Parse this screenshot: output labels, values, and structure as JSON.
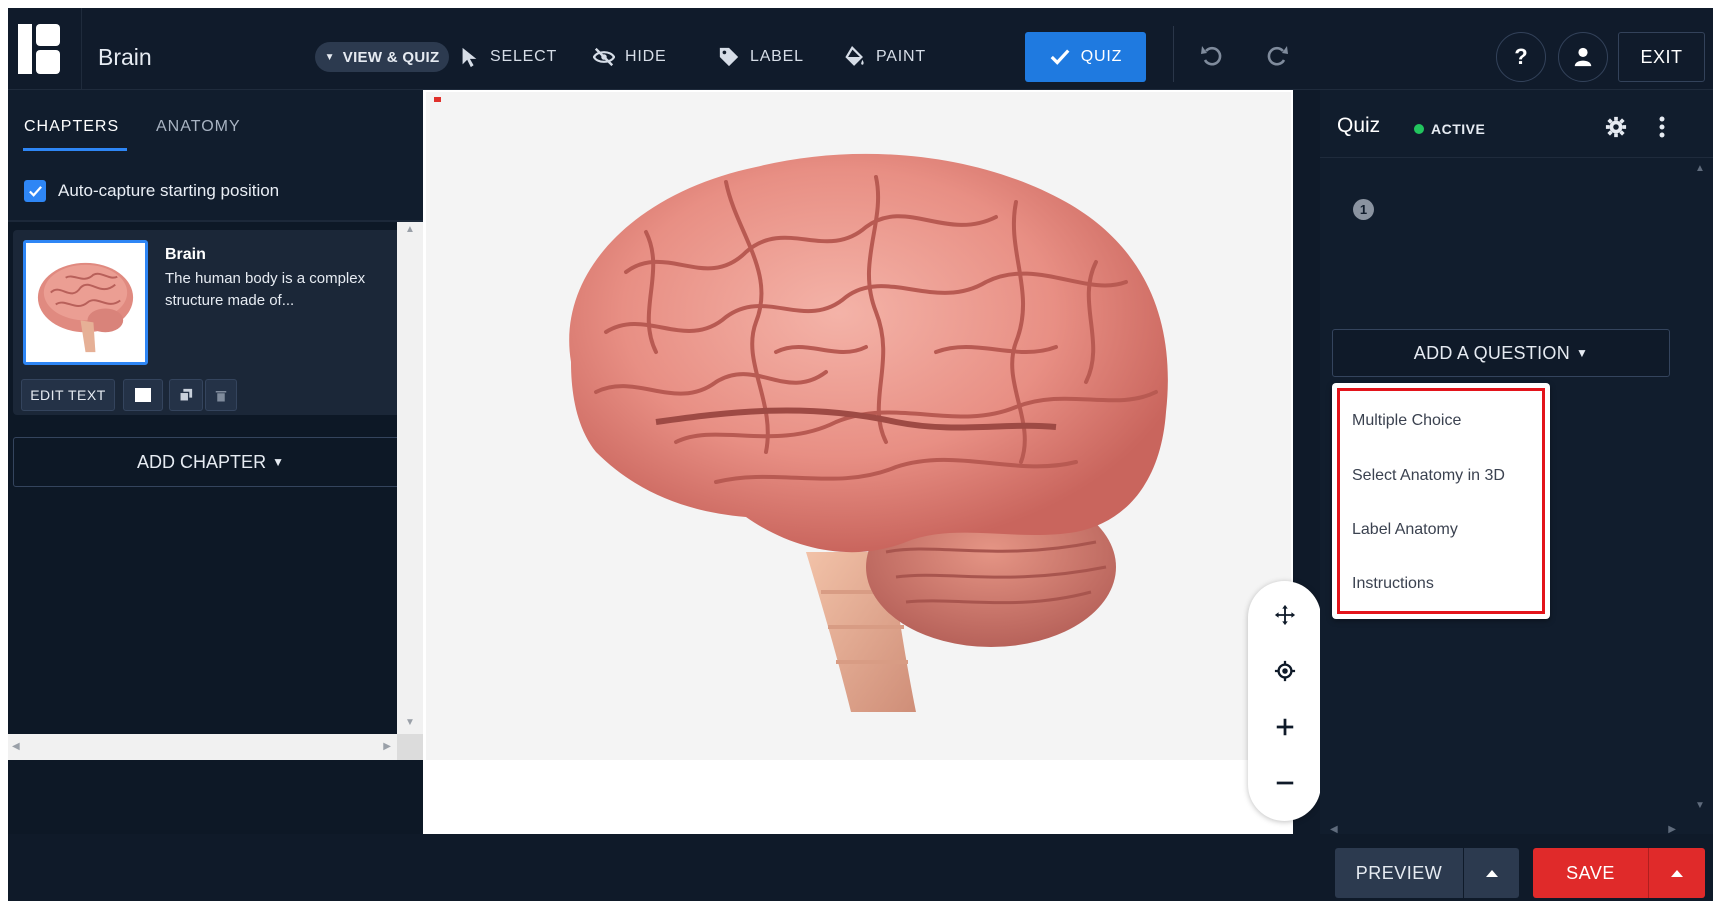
{
  "colors": {
    "accent": "#1f7ae0",
    "save": "#e02a2a",
    "active_status": "#22c55e",
    "highlight": "#e3141b"
  },
  "header": {
    "title": "Brain",
    "mode_label": "VIEW & QUIZ",
    "tools": [
      {
        "label": "SELECT",
        "icon": "cursor-icon"
      },
      {
        "label": "HIDE",
        "icon": "eye-slash-icon"
      },
      {
        "label": "LABEL",
        "icon": "tag-icon"
      },
      {
        "label": "PAINT",
        "icon": "paint-bucket-icon"
      },
      {
        "label": "QUIZ",
        "icon": "check-icon",
        "active": true
      }
    ],
    "help_label": "?",
    "exit_label": "EXIT"
  },
  "left_panel": {
    "tabs": [
      {
        "label": "CHAPTERS",
        "active": true
      },
      {
        "label": "ANATOMY",
        "active": false
      }
    ],
    "auto_capture_label": "Auto-capture starting position",
    "auto_capture_checked": true,
    "chapter": {
      "title": "Brain",
      "description": "The human body is a complex structure made of...",
      "edit_label": "EDIT TEXT"
    },
    "add_chapter_label": "ADD CHAPTER"
  },
  "right_panel": {
    "title": "Quiz",
    "status": "ACTIVE",
    "question_number": "1",
    "add_question_label": "ADD A QUESTION",
    "question_types": [
      "Multiple Choice",
      "Select Anatomy in 3D",
      "Label Anatomy",
      "Instructions"
    ]
  },
  "footer": {
    "preview_label": "PREVIEW",
    "save_label": "SAVE"
  }
}
